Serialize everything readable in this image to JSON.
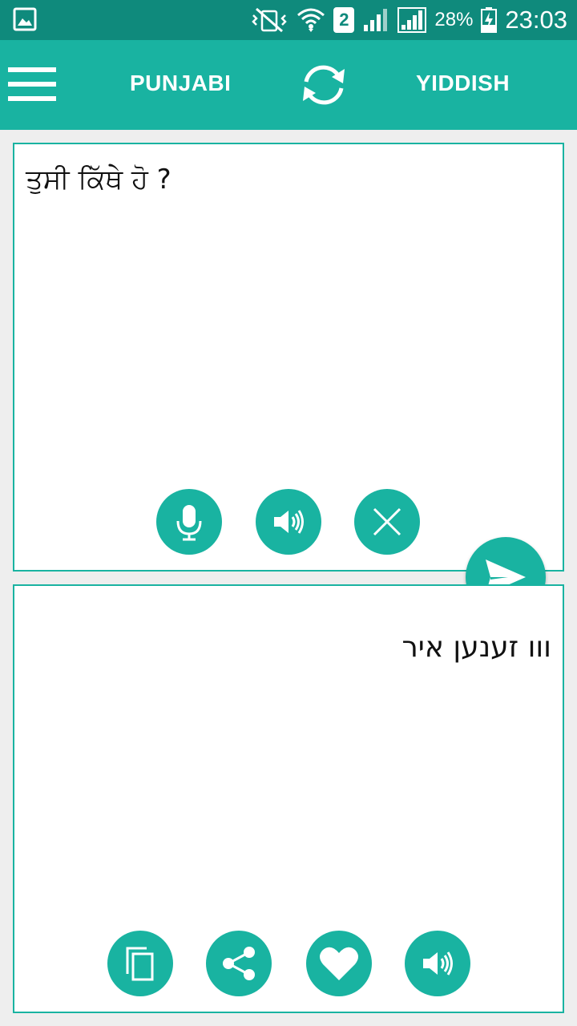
{
  "status_bar": {
    "battery_percent": "28%",
    "time": "23:03",
    "sim_slot": "2",
    "icons": [
      "gallery-icon",
      "mute-vibrate-icon",
      "wifi-icon",
      "sim-2-icon",
      "signal-icon",
      "signal-icon",
      "battery-charging-icon"
    ]
  },
  "toolbar": {
    "menu_icon": "hamburger-menu-icon",
    "source_language": "PUNJABI",
    "swap_icon": "swap-languages-icon",
    "target_language": "YIDDISH"
  },
  "source_panel": {
    "text": "ਤੁਸੀ ਕਿੱਥੇ ਹੋ ?",
    "buttons": [
      "microphone-icon",
      "speaker-icon",
      "clear-icon"
    ]
  },
  "send_button": {
    "icon": "send-icon"
  },
  "target_panel": {
    "text": "ווו זענען איר",
    "buttons": [
      "copy-icon",
      "share-icon",
      "favorite-icon",
      "speaker-icon"
    ]
  },
  "colors": {
    "accent": "#19b3a1",
    "status_bar": "#0f8a7c",
    "background": "#eeeeee",
    "panel": "#ffffff"
  }
}
